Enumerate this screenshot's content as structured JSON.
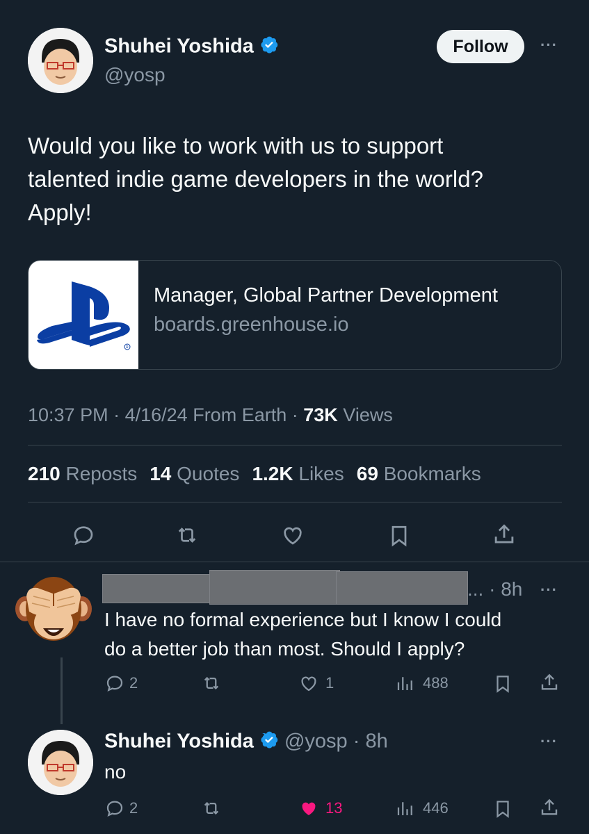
{
  "main_tweet": {
    "author_name": "Shuhei Yoshida",
    "handle": "@yosp",
    "follow_label": "Follow",
    "text_lines": [
      "Would you like to work with us to support",
      "talented indie game developers in the world?",
      "Apply!"
    ],
    "card": {
      "title": "Manager, Global Partner Development",
      "domain": "boards.greenhouse.io",
      "image_icon": "playstation-logo-icon"
    },
    "meta": {
      "time": "10:37 PM",
      "date": "4/16/24",
      "source": "From Earth",
      "views_count": "73K",
      "views_label": "Views"
    },
    "stats": [
      {
        "num": "210",
        "label": "Reposts"
      },
      {
        "num": "14",
        "label": "Quotes"
      },
      {
        "num": "1.2K",
        "label": "Likes"
      },
      {
        "num": "69",
        "label": "Bookmarks"
      }
    ]
  },
  "reply_1": {
    "name_redacted": "...",
    "time": "8h",
    "text_lines": [
      "I have no formal experience but I know I could",
      "do a better job than most. Should I apply?"
    ],
    "replies": "2",
    "likes": "1",
    "views": "488"
  },
  "reply_2": {
    "author_name": "Shuhei Yoshida",
    "handle": "@yosp",
    "time": "8h",
    "text": "no",
    "replies": "2",
    "likes": "13",
    "views": "446"
  },
  "colors": {
    "background": "#15202b",
    "verified_blue": "#1d9bf0",
    "like_pink": "#f91880",
    "muted": "#8b98a5"
  }
}
